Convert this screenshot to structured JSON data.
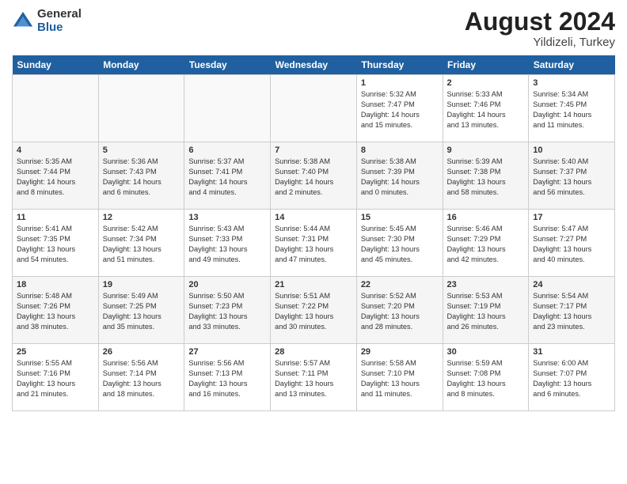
{
  "logo": {
    "general": "General",
    "blue": "Blue"
  },
  "title": {
    "month_year": "August 2024",
    "location": "Yildizeli, Turkey"
  },
  "days_of_week": [
    "Sunday",
    "Monday",
    "Tuesday",
    "Wednesday",
    "Thursday",
    "Friday",
    "Saturday"
  ],
  "weeks": [
    [
      {
        "day": "",
        "info": ""
      },
      {
        "day": "",
        "info": ""
      },
      {
        "day": "",
        "info": ""
      },
      {
        "day": "",
        "info": ""
      },
      {
        "day": "1",
        "info": "Sunrise: 5:32 AM\nSunset: 7:47 PM\nDaylight: 14 hours\nand 15 minutes."
      },
      {
        "day": "2",
        "info": "Sunrise: 5:33 AM\nSunset: 7:46 PM\nDaylight: 14 hours\nand 13 minutes."
      },
      {
        "day": "3",
        "info": "Sunrise: 5:34 AM\nSunset: 7:45 PM\nDaylight: 14 hours\nand 11 minutes."
      }
    ],
    [
      {
        "day": "4",
        "info": "Sunrise: 5:35 AM\nSunset: 7:44 PM\nDaylight: 14 hours\nand 8 minutes."
      },
      {
        "day": "5",
        "info": "Sunrise: 5:36 AM\nSunset: 7:43 PM\nDaylight: 14 hours\nand 6 minutes."
      },
      {
        "day": "6",
        "info": "Sunrise: 5:37 AM\nSunset: 7:41 PM\nDaylight: 14 hours\nand 4 minutes."
      },
      {
        "day": "7",
        "info": "Sunrise: 5:38 AM\nSunset: 7:40 PM\nDaylight: 14 hours\nand 2 minutes."
      },
      {
        "day": "8",
        "info": "Sunrise: 5:38 AM\nSunset: 7:39 PM\nDaylight: 14 hours\nand 0 minutes."
      },
      {
        "day": "9",
        "info": "Sunrise: 5:39 AM\nSunset: 7:38 PM\nDaylight: 13 hours\nand 58 minutes."
      },
      {
        "day": "10",
        "info": "Sunrise: 5:40 AM\nSunset: 7:37 PM\nDaylight: 13 hours\nand 56 minutes."
      }
    ],
    [
      {
        "day": "11",
        "info": "Sunrise: 5:41 AM\nSunset: 7:35 PM\nDaylight: 13 hours\nand 54 minutes."
      },
      {
        "day": "12",
        "info": "Sunrise: 5:42 AM\nSunset: 7:34 PM\nDaylight: 13 hours\nand 51 minutes."
      },
      {
        "day": "13",
        "info": "Sunrise: 5:43 AM\nSunset: 7:33 PM\nDaylight: 13 hours\nand 49 minutes."
      },
      {
        "day": "14",
        "info": "Sunrise: 5:44 AM\nSunset: 7:31 PM\nDaylight: 13 hours\nand 47 minutes."
      },
      {
        "day": "15",
        "info": "Sunrise: 5:45 AM\nSunset: 7:30 PM\nDaylight: 13 hours\nand 45 minutes."
      },
      {
        "day": "16",
        "info": "Sunrise: 5:46 AM\nSunset: 7:29 PM\nDaylight: 13 hours\nand 42 minutes."
      },
      {
        "day": "17",
        "info": "Sunrise: 5:47 AM\nSunset: 7:27 PM\nDaylight: 13 hours\nand 40 minutes."
      }
    ],
    [
      {
        "day": "18",
        "info": "Sunrise: 5:48 AM\nSunset: 7:26 PM\nDaylight: 13 hours\nand 38 minutes."
      },
      {
        "day": "19",
        "info": "Sunrise: 5:49 AM\nSunset: 7:25 PM\nDaylight: 13 hours\nand 35 minutes."
      },
      {
        "day": "20",
        "info": "Sunrise: 5:50 AM\nSunset: 7:23 PM\nDaylight: 13 hours\nand 33 minutes."
      },
      {
        "day": "21",
        "info": "Sunrise: 5:51 AM\nSunset: 7:22 PM\nDaylight: 13 hours\nand 30 minutes."
      },
      {
        "day": "22",
        "info": "Sunrise: 5:52 AM\nSunset: 7:20 PM\nDaylight: 13 hours\nand 28 minutes."
      },
      {
        "day": "23",
        "info": "Sunrise: 5:53 AM\nSunset: 7:19 PM\nDaylight: 13 hours\nand 26 minutes."
      },
      {
        "day": "24",
        "info": "Sunrise: 5:54 AM\nSunset: 7:17 PM\nDaylight: 13 hours\nand 23 minutes."
      }
    ],
    [
      {
        "day": "25",
        "info": "Sunrise: 5:55 AM\nSunset: 7:16 PM\nDaylight: 13 hours\nand 21 minutes."
      },
      {
        "day": "26",
        "info": "Sunrise: 5:56 AM\nSunset: 7:14 PM\nDaylight: 13 hours\nand 18 minutes."
      },
      {
        "day": "27",
        "info": "Sunrise: 5:56 AM\nSunset: 7:13 PM\nDaylight: 13 hours\nand 16 minutes."
      },
      {
        "day": "28",
        "info": "Sunrise: 5:57 AM\nSunset: 7:11 PM\nDaylight: 13 hours\nand 13 minutes."
      },
      {
        "day": "29",
        "info": "Sunrise: 5:58 AM\nSunset: 7:10 PM\nDaylight: 13 hours\nand 11 minutes."
      },
      {
        "day": "30",
        "info": "Sunrise: 5:59 AM\nSunset: 7:08 PM\nDaylight: 13 hours\nand 8 minutes."
      },
      {
        "day": "31",
        "info": "Sunrise: 6:00 AM\nSunset: 7:07 PM\nDaylight: 13 hours\nand 6 minutes."
      }
    ]
  ]
}
